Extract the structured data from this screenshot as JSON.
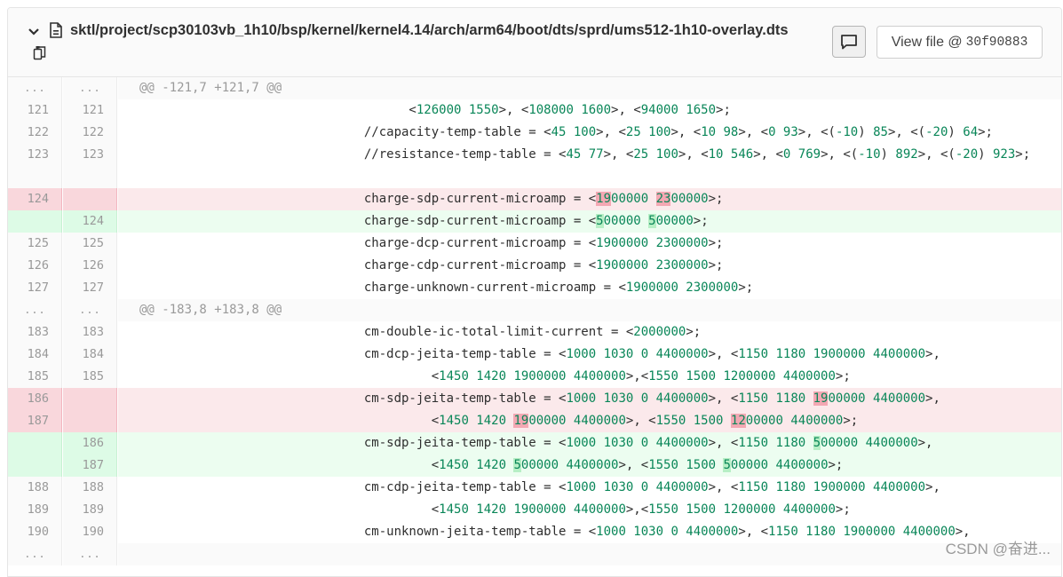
{
  "file": {
    "path_text": "sktl/project/scp30103vb_1h10/bsp/kernel/kernel4.14/arch/arm64/boot/dts/sprd/ums512-1h10-overlay.dts",
    "view_file_label": "View file @",
    "sha": "30f90883"
  },
  "diff": {
    "hunk1": "@@ -121,7 +121,7 @@",
    "hunk2": "@@ -183,8 +183,8 @@",
    "ellipsis": "...",
    "minus": "-",
    "plus": "+"
  },
  "watermark": "CSDN @奋进..."
}
